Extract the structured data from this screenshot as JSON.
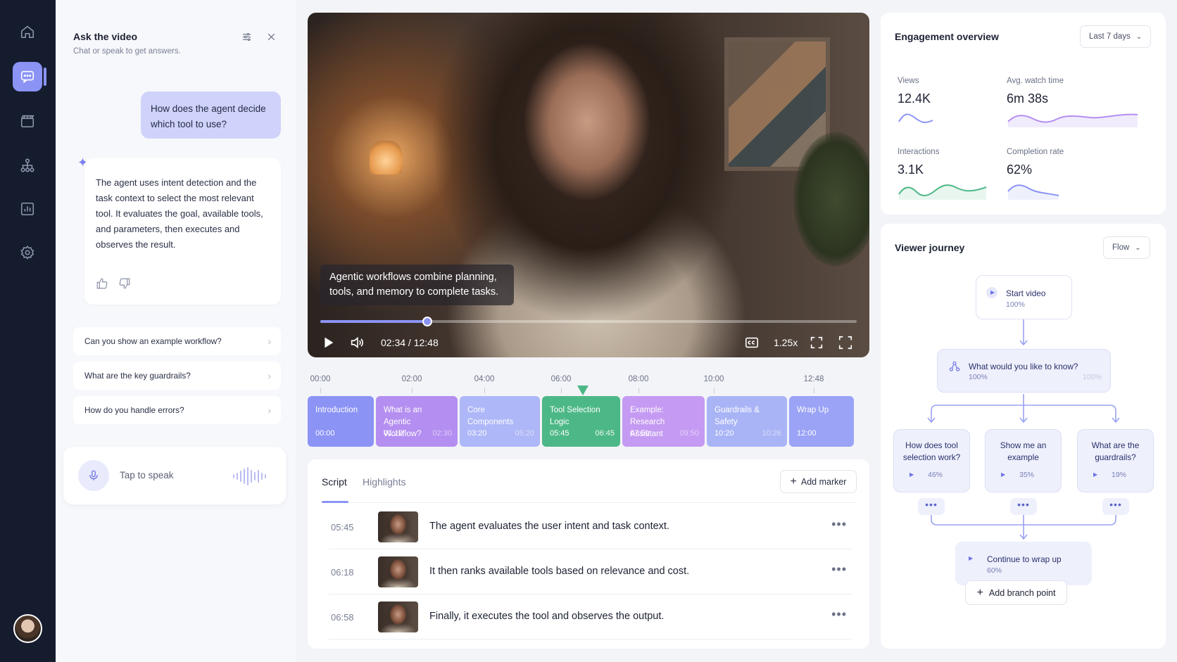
{
  "nav": {
    "items": [
      "home-icon",
      "chat-icon",
      "clapperboard-icon",
      "hierarchy-icon",
      "bar-chart-icon",
      "gear-icon"
    ],
    "active": "chat-icon",
    "user_avatar": "avatar"
  },
  "chat": {
    "title": "Ask the video",
    "subtitle": "Chat or speak to get answers.",
    "user_message": "How does the agent decide which tool to use?",
    "ai_answer": "The agent uses intent detection and the task context to select the most relevant tool. It evaluates the goal, available tools, and parameters, then executes and observes the result.",
    "suggestions": [
      "Can you show an example workflow?",
      "What are the key guardrails?",
      "How do you handle errors?"
    ],
    "speak_label": "Tap to speak"
  },
  "video": {
    "caption": "Agentic workflows combine planning, tools, and memory to complete tasks.",
    "time": "02:34 / 12:48",
    "progress_fraction": 0.2,
    "speed": "1.25x"
  },
  "timeline": {
    "ticks": [
      "00:00",
      "02:00",
      "04:00",
      "06:00",
      "08:00",
      "10:00",
      "12:48"
    ],
    "chapters": [
      {
        "title": "Introduction",
        "start": "00:00",
        "end": "",
        "color": "#8b93f5"
      },
      {
        "title": "What is an Agentic Workflow?",
        "start": "01:10",
        "end": "02:30",
        "color": "#b48ef0"
      },
      {
        "title": "Core Components",
        "start": "03:20",
        "end": "05:20",
        "color": "#aeb7f7"
      },
      {
        "title": "Tool Selection Logic",
        "start": "05:45",
        "end": "06:45",
        "color": "#4db887"
      },
      {
        "title": "Example: Research Assistant",
        "start": "07:50",
        "end": "09:50",
        "color": "#c49af2"
      },
      {
        "title": "Guardrails & Safety",
        "start": "10:20",
        "end": "10:26",
        "color": "#a9b4f6"
      },
      {
        "title": "Wrap Up",
        "start": "12:00",
        "end": "",
        "color": "#9aa3f6"
      }
    ]
  },
  "script": {
    "tabs": [
      "Script",
      "Highlights"
    ],
    "add_marker": "Add marker",
    "rows": [
      {
        "time": "05:45",
        "text": "The agent evaluates the user intent and task context."
      },
      {
        "time": "06:18",
        "text": "It then ranks available tools based on relevance and cost."
      },
      {
        "time": "06:58",
        "text": "Finally, it executes the tool and observes the output."
      }
    ]
  },
  "engagement": {
    "title": "Engagement overview",
    "range": "Last 7 days",
    "metrics": [
      {
        "label": "Views",
        "value": "12.4K",
        "color": "#8b93f5"
      },
      {
        "label": "Avg. watch time",
        "value": "6m 38s",
        "color": "#b48ef0"
      },
      {
        "label": "Interactions",
        "value": "3.1K",
        "color": "#4db887"
      },
      {
        "label": "Completion rate",
        "value": "62%",
        "color": "#8b93f5"
      }
    ]
  },
  "journey": {
    "title": "Viewer journey",
    "mode": "Flow",
    "start": {
      "label": "Start video",
      "pct": "100%"
    },
    "question": {
      "label": "What would you like to know?",
      "pct": "100%",
      "pct_right": "100%"
    },
    "branches": [
      {
        "label": "How does tool selection work?",
        "pct": "46%"
      },
      {
        "label": "Show me an example",
        "pct": "35%"
      },
      {
        "label": "What are the guardrails?",
        "pct": "19%"
      }
    ],
    "continue": {
      "label": "Continue to wrap up",
      "pct": "60%"
    },
    "add_branch": "Add branch point"
  }
}
